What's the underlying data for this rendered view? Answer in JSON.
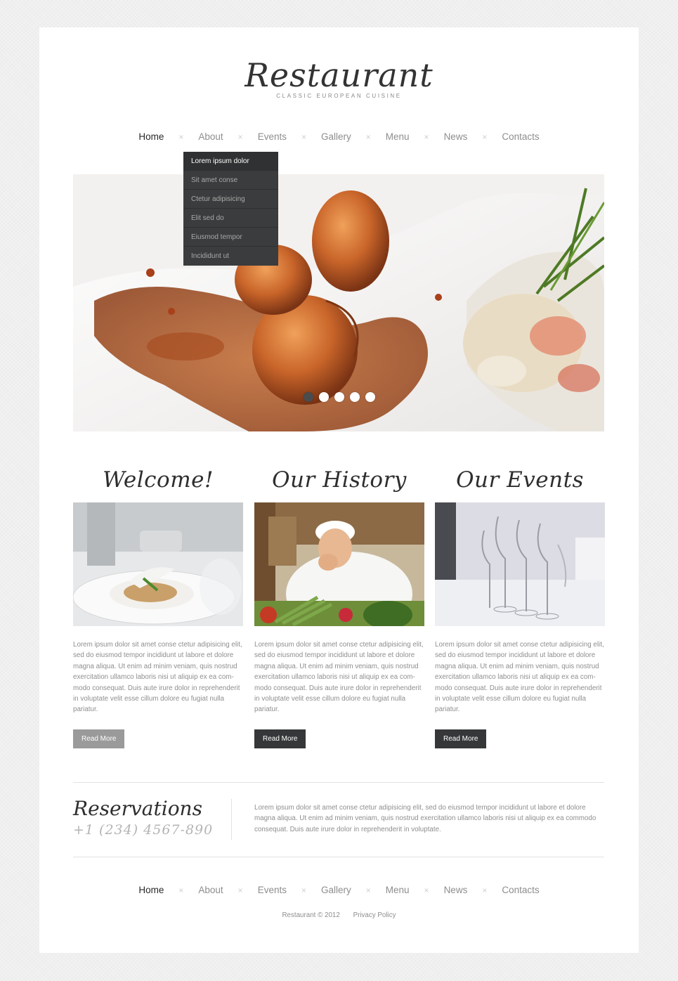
{
  "brand": {
    "title": "Restaurant",
    "tagline": "CLASSIC EUROPEAN CUISINE"
  },
  "nav": {
    "items": [
      {
        "label": "Home",
        "active": true
      },
      {
        "label": "About"
      },
      {
        "label": "Events"
      },
      {
        "label": "Gallery"
      },
      {
        "label": "Menu"
      },
      {
        "label": "News"
      },
      {
        "label": "Contacts"
      }
    ],
    "separator": "×"
  },
  "dropdown": {
    "items": [
      {
        "label": "Lorem ipsum dolor",
        "active": true
      },
      {
        "label": "Sit amet conse"
      },
      {
        "label": "Ctetur adipisicing"
      },
      {
        "label": "Elit sed do"
      },
      {
        "label": "Eiusmod tempor"
      },
      {
        "label": "Incididunt ut"
      }
    ]
  },
  "slider": {
    "image_icon": "shrimp-dish-photo",
    "active_dot": 0,
    "dot_count": 5
  },
  "columns": [
    {
      "title": "Welcome!",
      "image_icon": "plated-dish-photo",
      "text": "Lorem ipsum dolor sit amet conse ctetur adipisicing elit, sed do eiusmod tempor incididunt ut labore et dolore magna aliqua. Ut enim ad minim veniam, quis nostrud exercitation ullamco laboris nisi ut aliquip ex ea com-modo consequat. Duis aute irure dolor in reprehenderit in voluptate velit esse cillum dolore eu fugiat nulla pariatur.",
      "button": "Read More"
    },
    {
      "title": "Our History",
      "image_icon": "chef-photo",
      "text": "Lorem ipsum dolor sit amet conse ctetur adipisicing elit, sed do eiusmod tempor incididunt ut labore et dolore magna aliqua. Ut enim ad minim veniam, quis nostrud exercitation ullamco laboris nisi ut aliquip ex ea com-modo consequat. Duis aute irure dolor in reprehenderit in voluptate velit esse cillum dolore eu fugiat nulla pariatur.",
      "button": "Read More"
    },
    {
      "title": "Our Events",
      "image_icon": "wine-glasses-photo",
      "text": "Lorem ipsum dolor sit amet conse ctetur adipisicing elit, sed do eiusmod tempor incididunt ut labore et dolore magna aliqua. Ut enim ad minim veniam, quis nostrud exercitation ullamco laboris nisi ut aliquip ex ea com-modo consequat. Duis aute irure dolor in reprehenderit in voluptate velit esse cillum dolore eu fugiat nulla pariatur.",
      "button": "Read More"
    }
  ],
  "reservations": {
    "title": "Reservations",
    "phone": "+1 (234) 4567-890",
    "text": "Lorem ipsum dolor sit amet conse ctetur adipisicing elit, sed do eiusmod tempor incididunt ut labore et dolore magna aliqua. Ut enim ad minim veniam, quis nostrud exercitation ullamco laboris nisi ut aliquip ex ea commodo consequat. Duis aute irure dolor in reprehenderit in voluptate."
  },
  "footer": {
    "copyright": "Restaurant © 2012",
    "privacy": "Privacy Policy"
  },
  "colors": {
    "dark": "#353738",
    "text": "#8e8e8e",
    "background": "#efefef"
  }
}
